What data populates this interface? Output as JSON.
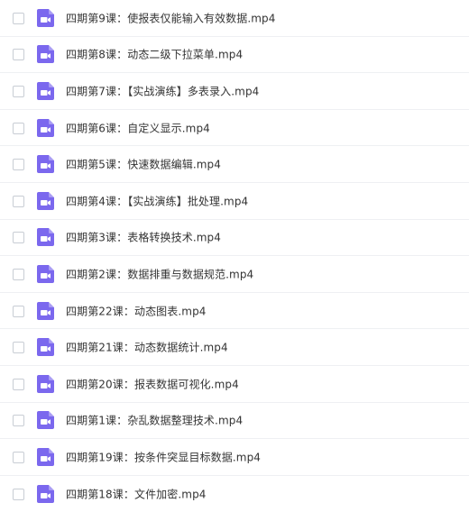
{
  "colors": {
    "icon_bg": "#7b68ee",
    "text": "#333333",
    "divider": "#eef0f3",
    "checkbox_border": "#c8cdd4"
  },
  "icon_name": "video-file-icon",
  "files": [
    {
      "name": "四期第9课：使报表仅能输入有效数据.mp4"
    },
    {
      "name": "四期第8课：动态二级下拉菜单.mp4"
    },
    {
      "name": "四期第7课：【实战演练】多表录入.mp4"
    },
    {
      "name": "四期第6课：自定义显示.mp4"
    },
    {
      "name": "四期第5课：快速数据编辑.mp4"
    },
    {
      "name": "四期第4课：【实战演练】批处理.mp4"
    },
    {
      "name": "四期第3课：表格转换技术.mp4"
    },
    {
      "name": "四期第2课：数据排重与数据规范.mp4"
    },
    {
      "name": "四期第22课：动态图表.mp4"
    },
    {
      "name": "四期第21课：动态数据统计.mp4"
    },
    {
      "name": "四期第20课：报表数据可视化.mp4"
    },
    {
      "name": "四期第1课：杂乱数据整理技术.mp4"
    },
    {
      "name": "四期第19课：按条件突显目标数据.mp4"
    },
    {
      "name": "四期第18课：文件加密.mp4"
    }
  ]
}
